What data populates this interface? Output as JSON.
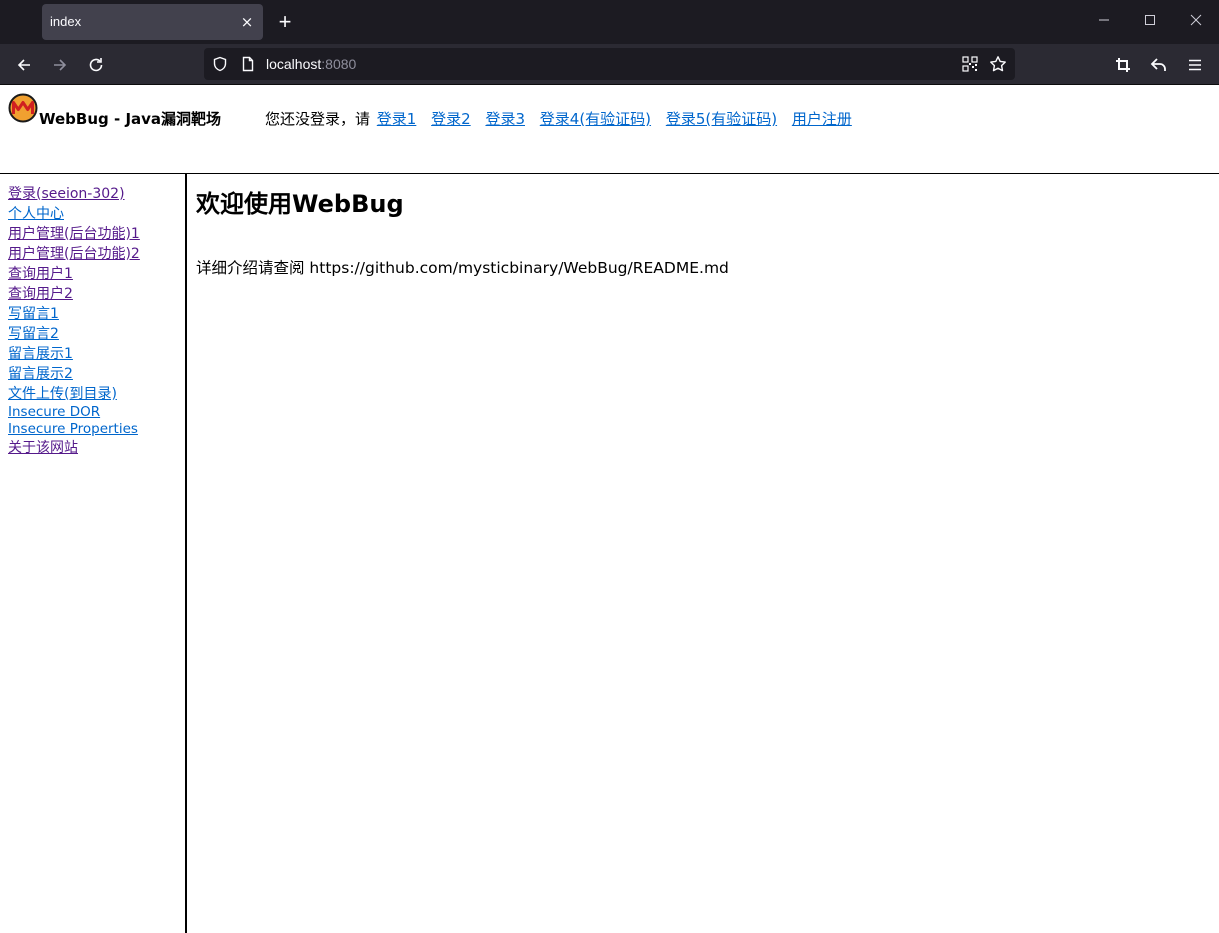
{
  "browser": {
    "tab_title": "index",
    "tab_close": "×",
    "new_tab": "+",
    "url_host": "localhost",
    "url_port": ":8080",
    "window_controls": {
      "minimize": "—",
      "maximize": "☐",
      "close": "✕"
    }
  },
  "header": {
    "site_title": "WebBug - Java漏洞靶场",
    "login_prompt": "您还没登录，请",
    "login_links": [
      "登录1",
      "登录2",
      "登录3",
      "登录4(有验证码)",
      "登录5(有验证码)",
      "用户注册"
    ]
  },
  "sidebar": {
    "items": [
      {
        "label": "登录(seeion-302)",
        "state": "visited"
      },
      {
        "label": "个人中心",
        "state": "link"
      },
      {
        "label": "用户管理(后台功能)1",
        "state": "visited"
      },
      {
        "label": "用户管理(后台功能)2",
        "state": "visited"
      },
      {
        "label": "查询用户1",
        "state": "visited"
      },
      {
        "label": "查询用户2",
        "state": "visited"
      },
      {
        "label": "写留言1",
        "state": "link"
      },
      {
        "label": "写留言2",
        "state": "link"
      },
      {
        "label": "留言展示1",
        "state": "link"
      },
      {
        "label": "留言展示2",
        "state": "link"
      },
      {
        "label": "文件上传(到目录)",
        "state": "link"
      },
      {
        "label": "Insecure DOR",
        "state": "link"
      },
      {
        "label": "Insecure Properties",
        "state": "link"
      },
      {
        "label": "关于该网站",
        "state": "visited"
      }
    ]
  },
  "main": {
    "heading": "欢迎使用WebBug",
    "description": "详细介绍请查阅 https://github.com/mysticbinary/WebBug/README.md"
  },
  "colors": {
    "link": "#0066cc",
    "visited": "#551a8b",
    "chrome_dark": "#1c1b22",
    "chrome_toolbar": "#2b2a33"
  }
}
